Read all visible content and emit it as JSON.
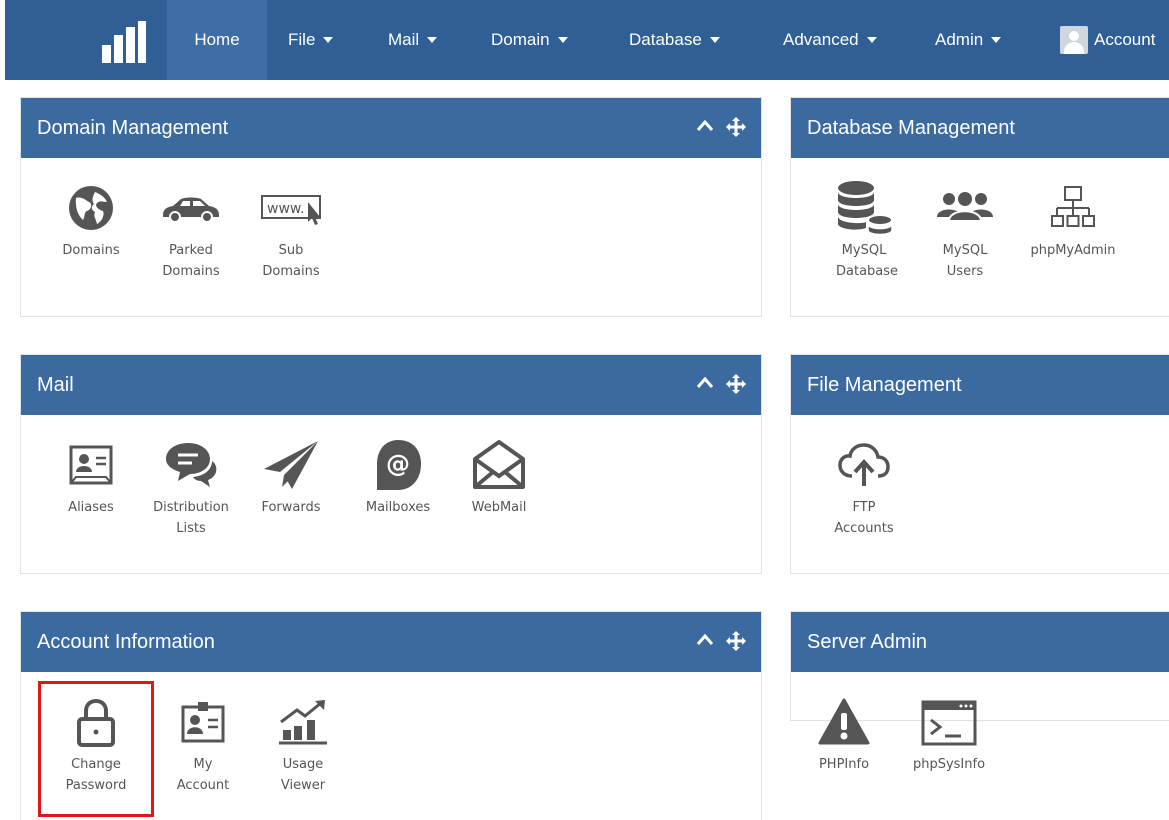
{
  "navbar": {
    "items": [
      {
        "label": "Home",
        "dropdown": false,
        "active": true
      },
      {
        "label": "File",
        "dropdown": true
      },
      {
        "label": "Mail",
        "dropdown": true
      },
      {
        "label": "Domain",
        "dropdown": true
      },
      {
        "label": "Database",
        "dropdown": true
      },
      {
        "label": "Advanced",
        "dropdown": true
      },
      {
        "label": "Admin",
        "dropdown": true
      }
    ],
    "account_label": "Account"
  },
  "panels": {
    "domain": {
      "title": "Domain Management",
      "tiles": [
        {
          "label": "Domains",
          "icon": "globe-icon"
        },
        {
          "label": "Parked Domains",
          "icon": "car-icon"
        },
        {
          "label": "Sub Domains",
          "icon": "www-icon"
        }
      ]
    },
    "database": {
      "title": "Database Management",
      "tiles": [
        {
          "label": "MySQL Database",
          "icon": "database-icon"
        },
        {
          "label": "MySQL Users",
          "icon": "users-icon"
        },
        {
          "label": "phpMyAdmin",
          "icon": "sitemap-icon"
        }
      ]
    },
    "mail": {
      "title": "Mail",
      "tiles": [
        {
          "label": "Aliases",
          "icon": "id-card-icon"
        },
        {
          "label": "Distribution Lists",
          "icon": "chat-bubbles-icon"
        },
        {
          "label": "Forwards",
          "icon": "paper-plane-icon"
        },
        {
          "label": "Mailboxes",
          "icon": "at-sign-icon"
        },
        {
          "label": "WebMail",
          "icon": "envelope-open-icon"
        }
      ]
    },
    "file": {
      "title": "File Management",
      "tiles": [
        {
          "label": "FTP Accounts",
          "icon": "cloud-upload-icon"
        }
      ]
    },
    "account": {
      "title": "Account Information",
      "tiles": [
        {
          "label": "Change Password",
          "icon": "padlock-icon",
          "selected": true
        },
        {
          "label": "My Account",
          "icon": "id-badge-icon"
        },
        {
          "label": "Usage Viewer",
          "icon": "bar-chart-icon"
        }
      ]
    },
    "server": {
      "title": "Server Admin",
      "tiles": [
        {
          "label": "PHPInfo",
          "icon": "warning-icon"
        },
        {
          "label": "phpSysInfo",
          "icon": "terminal-icon"
        }
      ]
    }
  },
  "colors": {
    "navbar_bg": "#2f5f95",
    "nav_active_bg": "#3f6da5",
    "panel_header_bg": "#3a6aa0",
    "icon_gray": "#555555",
    "selection_outline": "#e0161b"
  }
}
